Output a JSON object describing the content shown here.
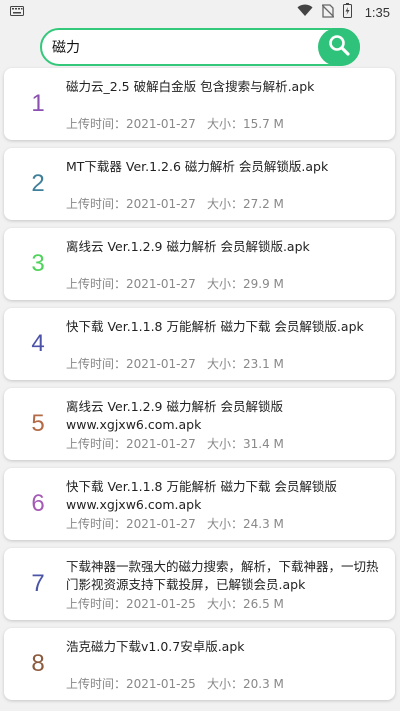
{
  "status_bar": {
    "time": "1:35",
    "icons": [
      "keyboard-icon",
      "wifi-icon",
      "no-sim-icon",
      "battery-icon"
    ]
  },
  "search": {
    "value": "磁力",
    "button_icon": "search-icon",
    "accent_color": "#2fc27a"
  },
  "labels": {
    "upload_time": "上传时间：",
    "size": "大小："
  },
  "items": [
    {
      "num": "1",
      "color": "#8a4fb0",
      "title": "磁力云_2.5 破解白金版 包含搜索与解析.apk",
      "date": "2021-01-27",
      "size": "15.7 M"
    },
    {
      "num": "2",
      "color": "#3f7f99",
      "title": "MT下载器 Ver.1.2.6 磁力解析 会员解锁版.apk",
      "date": "2021-01-27",
      "size": "27.2 M"
    },
    {
      "num": "3",
      "color": "#4fd35a",
      "title": "离线云 Ver.1.2.9 磁力解析 会员解锁版.apk",
      "date": "2021-01-27",
      "size": "29.9 M"
    },
    {
      "num": "4",
      "color": "#4c53a8",
      "title": "快下载 Ver.1.1.8 万能解析 磁力下载 会员解锁版.apk",
      "date": "2021-01-27",
      "size": "23.1 M"
    },
    {
      "num": "5",
      "color": "#b56a47",
      "title": "离线云 Ver.1.2.9 磁力解析 会员解锁版 www.xgjxw6.com.apk",
      "date": "2021-01-27",
      "size": "31.4 M"
    },
    {
      "num": "6",
      "color": "#a55bb5",
      "title": "快下载 Ver.1.1.8 万能解析 磁力下载 会员解锁版 www.xgjxw6.com.apk",
      "date": "2021-01-27",
      "size": "24.3 M"
    },
    {
      "num": "7",
      "color": "#4a55a8",
      "title": "下载神器一款强大的磁力搜索，解析，下载神器，一切热门影视资源支持下载投屏，已解锁会员.apk",
      "date": "2021-01-25",
      "size": "26.5 M"
    },
    {
      "num": "8",
      "color": "#8b5a3c",
      "title": "浩克磁力下载v1.0.7安卓版.apk",
      "date": "2021-01-25",
      "size": "20.3 M"
    }
  ]
}
